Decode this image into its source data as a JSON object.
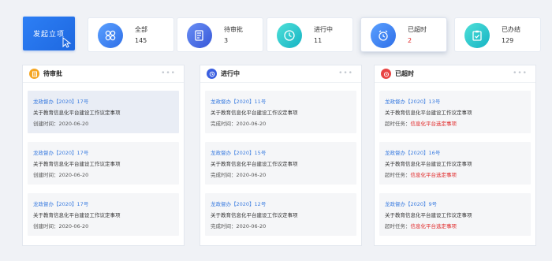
{
  "launch_button": {
    "label": "发起立项"
  },
  "stats": [
    {
      "label": "全部",
      "count": "145",
      "icon": "grid-icon",
      "color": "#3b82f6"
    },
    {
      "label": "待审批",
      "count": "3",
      "icon": "document-edit-icon",
      "color": "#3b6fe0"
    },
    {
      "label": "进行中",
      "count": "11",
      "icon": "clock-icon",
      "color": "#1fc7c9"
    },
    {
      "label": "已超时",
      "count": "2",
      "icon": "alarm-clock-icon",
      "color": "#3b82f6",
      "count_color": "#e02424"
    },
    {
      "label": "已办结",
      "count": "129",
      "icon": "clipboard-check-icon",
      "color": "#1fc7c9"
    }
  ],
  "panels": [
    {
      "title": "待审批",
      "icon_color": "#f5a623",
      "items": [
        {
          "code": "龙政督办【2020】17号",
          "desc": "关于教育信息化平台建设工作议定事项",
          "meta_label": "创建时间：",
          "meta_value": "2020-06-20"
        },
        {
          "code": "龙政督办【2020】17号",
          "desc": "关于教育信息化平台建设工作议定事项",
          "meta_label": "创建时间：",
          "meta_value": "2020-06-20"
        },
        {
          "code": "龙政督办【2020】17号",
          "desc": "关于教育信息化平台建设工作议定事项",
          "meta_label": "创建时间：",
          "meta_value": "2020-06-20"
        }
      ]
    },
    {
      "title": "进行中",
      "icon_color": "#3b5fe0",
      "items": [
        {
          "code": "龙政督办【2020】11号",
          "desc": "关于教育信息化平台建设工作议定事项",
          "meta_label": "完成时间：",
          "meta_value": "2020-06-20"
        },
        {
          "code": "龙政督办【2020】15号",
          "desc": "关于教育信息化平台建设工作议定事项",
          "meta_label": "完成时间：",
          "meta_value": "2020-06-20"
        },
        {
          "code": "龙政督办【2020】12号",
          "desc": "关于教育信息化平台建设工作议定事项",
          "meta_label": "完成时间：",
          "meta_value": "2020-06-20"
        }
      ]
    },
    {
      "title": "已超时",
      "icon_color": "#e84545",
      "items": [
        {
          "code": "龙政督办【2020】13号",
          "desc": "关于教育信息化平台建设工作议定事项",
          "meta_label": "超时任务：",
          "meta_value": "信息化平台选定事项"
        },
        {
          "code": "龙政督办【2020】16号",
          "desc": "关于教育信息化平台建设工作议定事项",
          "meta_label": "超时任务：",
          "meta_value": "信息化平台选定事项"
        },
        {
          "code": "龙政督办【2020】9号",
          "desc": "关于教育信息化平台建设工作议定事项",
          "meta_label": "超时任务：",
          "meta_value": "信息化平台选定事项"
        }
      ]
    }
  ],
  "more_glyph": "•••"
}
